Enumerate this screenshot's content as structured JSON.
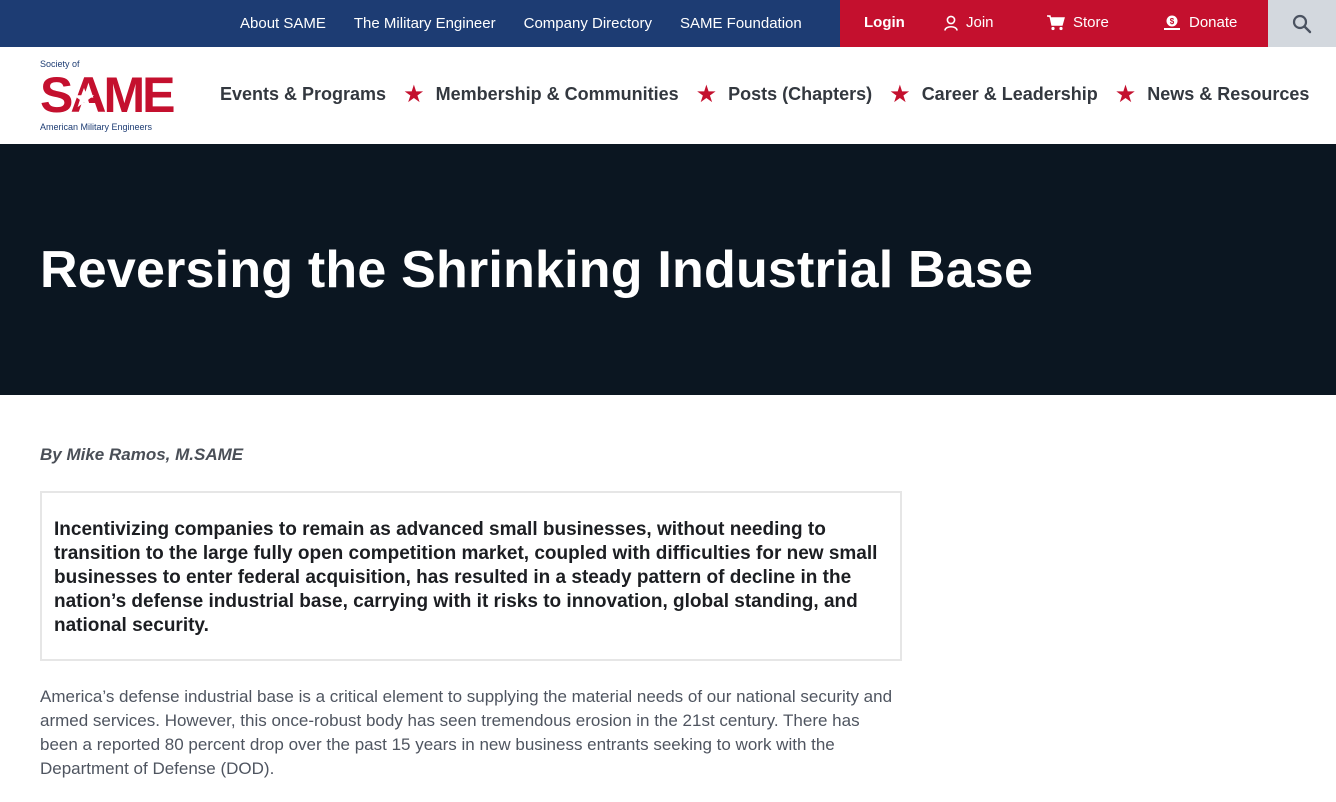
{
  "topbar": {
    "links": [
      "About SAME",
      "The Military Engineer",
      "Company Directory",
      "SAME Foundation"
    ],
    "login": "Login",
    "join": "Join",
    "store": "Store",
    "donate": "Donate",
    "colors": {
      "blue": "#1d3c73",
      "red": "#c4102e",
      "search_bg": "#d3d8de"
    }
  },
  "logo": {
    "top_text": "Society of",
    "word": "SAME",
    "bottom_text": "American Military Engineers"
  },
  "nav": {
    "items": [
      "Events & Programs",
      "Membership & Communities",
      "Posts (Chapters)",
      "Career & Leadership",
      "News & Resources"
    ],
    "separator": "★"
  },
  "hero": {
    "title": "Reversing the Shrinking Industrial Base",
    "bg": "#0b1621"
  },
  "article": {
    "byline": "By Mike Ramos, M.SAME",
    "pullquote": "Incentivizing companies to remain as advanced small businesses, without needing to transition to the large fully open competition market, coupled with difficulties for new small businesses to enter federal acquisition, has resulted in a steady pattern of decline in the nation’s defense industrial base, carrying with it risks to innovation, global standing, and national security.",
    "paragraph1": "America’s defense industrial base is a critical element to supplying the material needs of our national security and armed services. However, this once-robust body has seen tremendous erosion in the 21st century. There has been a reported 80 percent drop over the past 15 years in new business entrants seeking to work with the Department of Defense (DOD)."
  }
}
